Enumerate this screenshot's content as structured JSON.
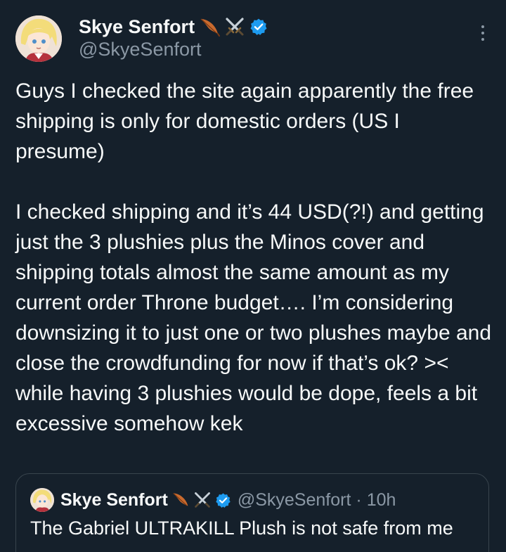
{
  "tweet": {
    "author": {
      "display_name": "Skye Senfort",
      "handle": "@SkyeSenfort",
      "name_emojis": [
        "feather-icon",
        "crossed-swords-icon"
      ],
      "verified_icon": "verified-badge-icon"
    },
    "more_icon": "more-options-icon",
    "paragraphs": [
      "Guys I checked the site again apparently the free shipping is only for domestic orders (US I presume)",
      "I checked shipping and it’s 44 USD(?!) and getting just the 3 plushies plus the Minos cover and shipping totals almost the same amount as my current order Throne budget…. I’m considering downsizing it to just one or two plushes maybe and close the crowdfunding for now if that’s ok? >< while having 3 plushies would be dope, feels a bit excessive somehow kek"
    ]
  },
  "quoted_tweet": {
    "display_name": "Skye Senfort",
    "handle": "@SkyeSenfort",
    "separator": "·",
    "time": "10h",
    "text": "The Gabriel ULTRAKILL Plush is not safe from me"
  },
  "colors": {
    "background": "#15202b",
    "text_primary": "#f7f9f9",
    "text_secondary": "#8b98a5",
    "border": "#38444d",
    "verified_blue": "#1d9bf0"
  }
}
